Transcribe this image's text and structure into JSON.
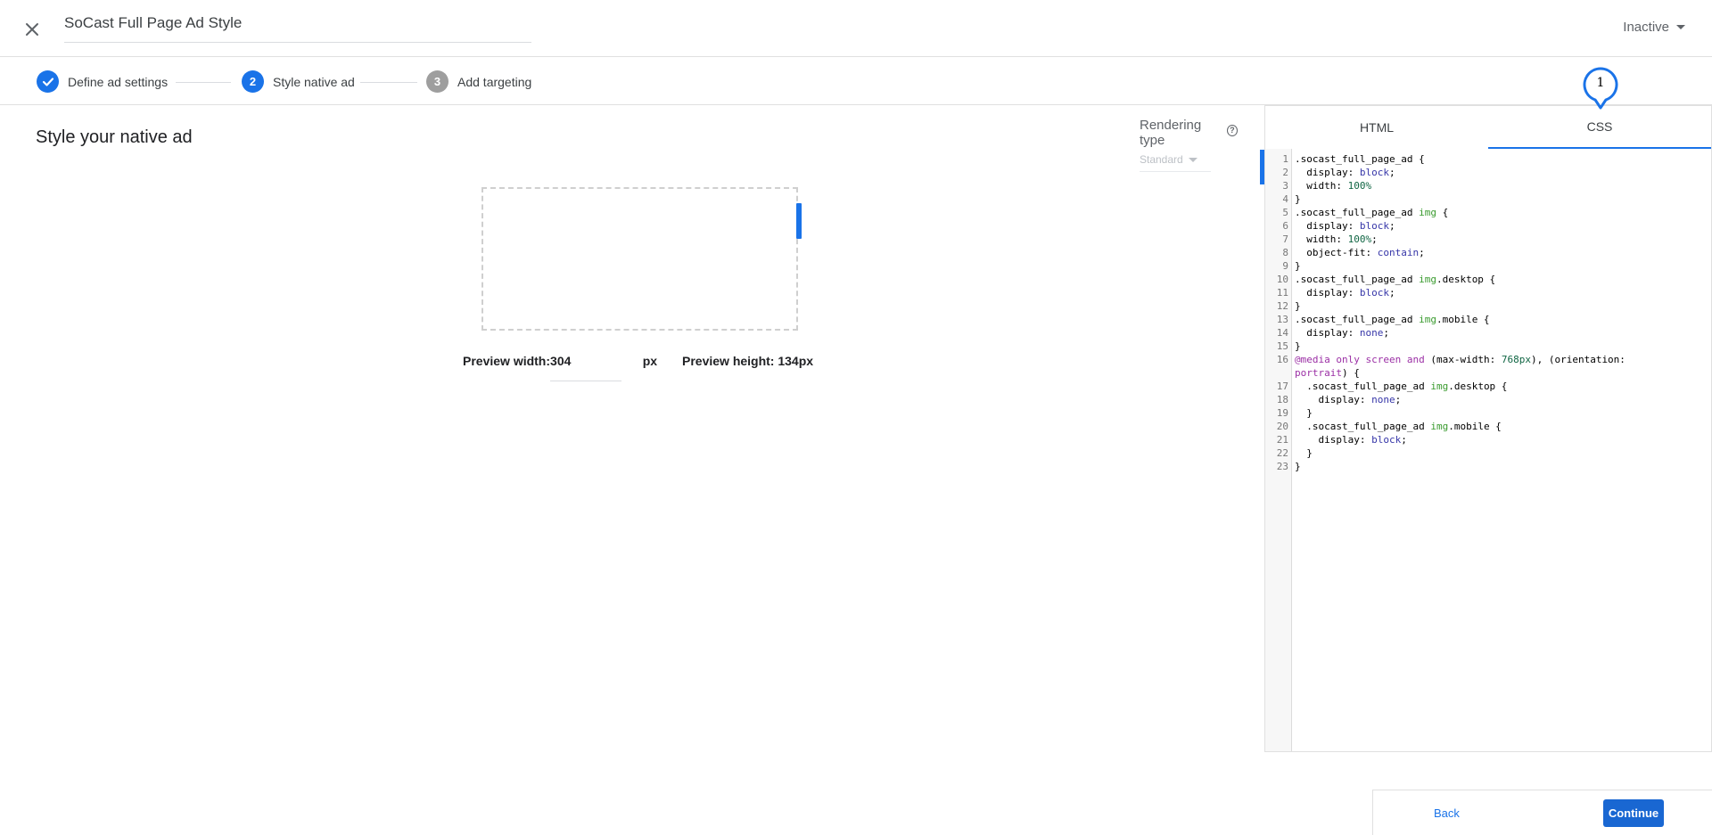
{
  "header": {
    "title": "SoCast Full Page Ad Style",
    "status": "Inactive"
  },
  "stepper": {
    "steps": [
      {
        "label": "Define ad settings",
        "marker": "check",
        "state": "completed"
      },
      {
        "label": "Style native ad",
        "marker": "2",
        "state": "active"
      },
      {
        "label": "Add targeting",
        "marker": "3",
        "state": "upcoming"
      }
    ]
  },
  "main": {
    "heading": "Style your native ad",
    "rendering_type": {
      "label": "Rendering type",
      "value": "Standard"
    },
    "preview": {
      "width_label": "Preview width:",
      "width_value": "304",
      "width_unit": "px",
      "height_label": "Preview height: 134px"
    }
  },
  "code_panel": {
    "tabs": [
      {
        "label": "HTML",
        "active": false
      },
      {
        "label": "CSS",
        "active": true
      }
    ],
    "pin_label": "1",
    "lines": [
      ".socast_full_page_ad {",
      "  display: block;",
      "  width: 100%",
      "}",
      ".socast_full_page_ad img {",
      "  display: block;",
      "  width: 100%;",
      "  object-fit: contain;",
      "}",
      ".socast_full_page_ad img.desktop {",
      "  display: block;",
      "}",
      ".socast_full_page_ad img.mobile {",
      "  display: none;",
      "}",
      "@media only screen and (max-width: 768px), (orientation: \nportrait) {",
      "  .socast_full_page_ad img.desktop {",
      "    display: none;",
      "  }",
      "  .socast_full_page_ad img.mobile {",
      "    display: block;",
      "  }",
      "}"
    ]
  },
  "footer": {
    "back_label": "Back",
    "continue_label": "Continue"
  },
  "colors": {
    "accent": "#1a73e8",
    "primary_button": "#1967d2",
    "step_inactive": "#9e9e9e"
  },
  "icons": {
    "close": "close-icon",
    "check": "check-icon",
    "help": "help-circle-icon",
    "caret": "caret-down-icon"
  }
}
